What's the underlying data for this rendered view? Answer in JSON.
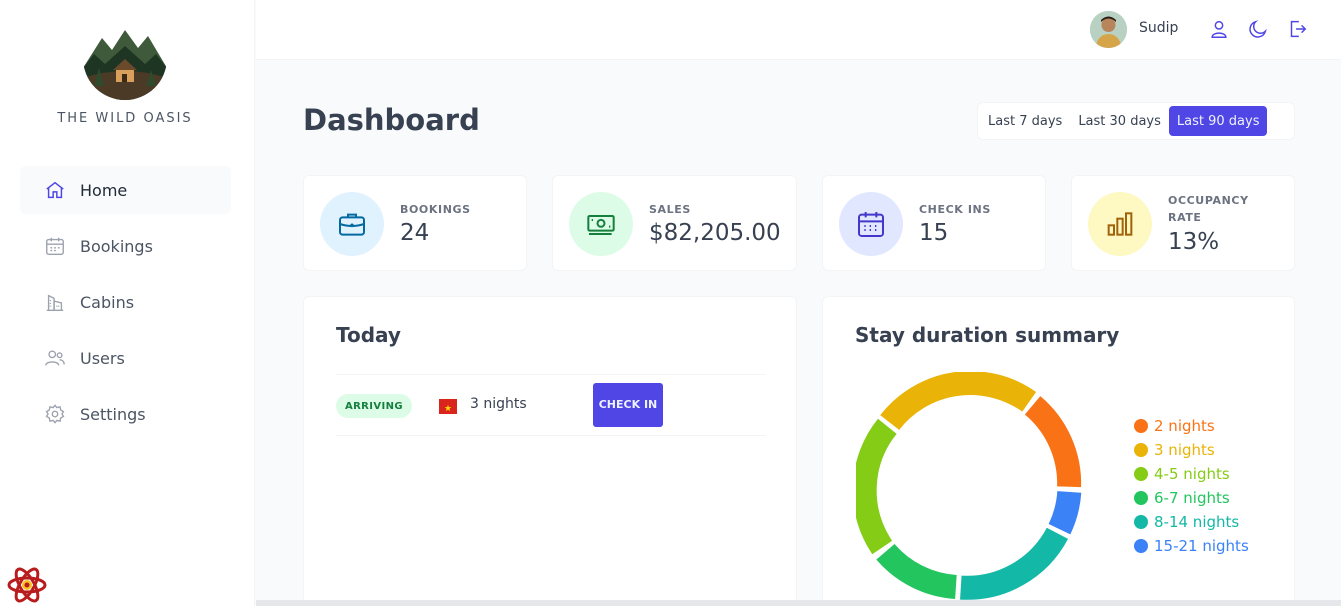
{
  "brand": "THE WILD OASIS",
  "sidebar": {
    "items": [
      {
        "label": "Home",
        "icon": "home-icon"
      },
      {
        "label": "Bookings",
        "icon": "calendar-icon"
      },
      {
        "label": "Cabins",
        "icon": "building-icon"
      },
      {
        "label": "Users",
        "icon": "users-icon"
      },
      {
        "label": "Settings",
        "icon": "gear-icon"
      }
    ]
  },
  "header": {
    "username": "Sudip"
  },
  "page_title": "Dashboard",
  "filter": {
    "options": [
      "Last 7 days",
      "Last 30 days",
      "Last 90 days"
    ],
    "selected": "Last 90 days"
  },
  "stats": [
    {
      "label": "BOOKINGS",
      "value": "24",
      "icon": "briefcase-icon",
      "color": "#0369a1",
      "bg": "#e0f2fe"
    },
    {
      "label": "SALES",
      "value": "$82,205.00",
      "icon": "banknotes-icon",
      "color": "#15803d",
      "bg": "#dcfce7"
    },
    {
      "label": "CHECK INS",
      "value": "15",
      "icon": "calendar-days-icon",
      "color": "#4338ca",
      "bg": "#e0e7ff"
    },
    {
      "label_line1": "OCCUPANCY",
      "label_line2": "RATE",
      "value": "13%",
      "icon": "chart-bar-icon",
      "color": "#a16207",
      "bg": "#fef9c3"
    }
  ],
  "today": {
    "title": "Today",
    "activities": [
      {
        "status": "ARRIVING",
        "nights": "3 nights",
        "action": "CHECK IN"
      }
    ]
  },
  "stay_duration": {
    "title": "Stay duration summary",
    "legend": [
      {
        "label": "2 nights",
        "color": "#f97316"
      },
      {
        "label": "3 nights",
        "color": "#eab308"
      },
      {
        "label": "4-5 nights",
        "color": "#84cc16"
      },
      {
        "label": "6-7 nights",
        "color": "#22c55e"
      },
      {
        "label": "8-14 nights",
        "color": "#14b8a6"
      },
      {
        "label": "15-21 nights",
        "color": "#3b82f6"
      }
    ]
  },
  "colors": {
    "brand": "#4f46e5",
    "background": "#f9fafb"
  }
}
